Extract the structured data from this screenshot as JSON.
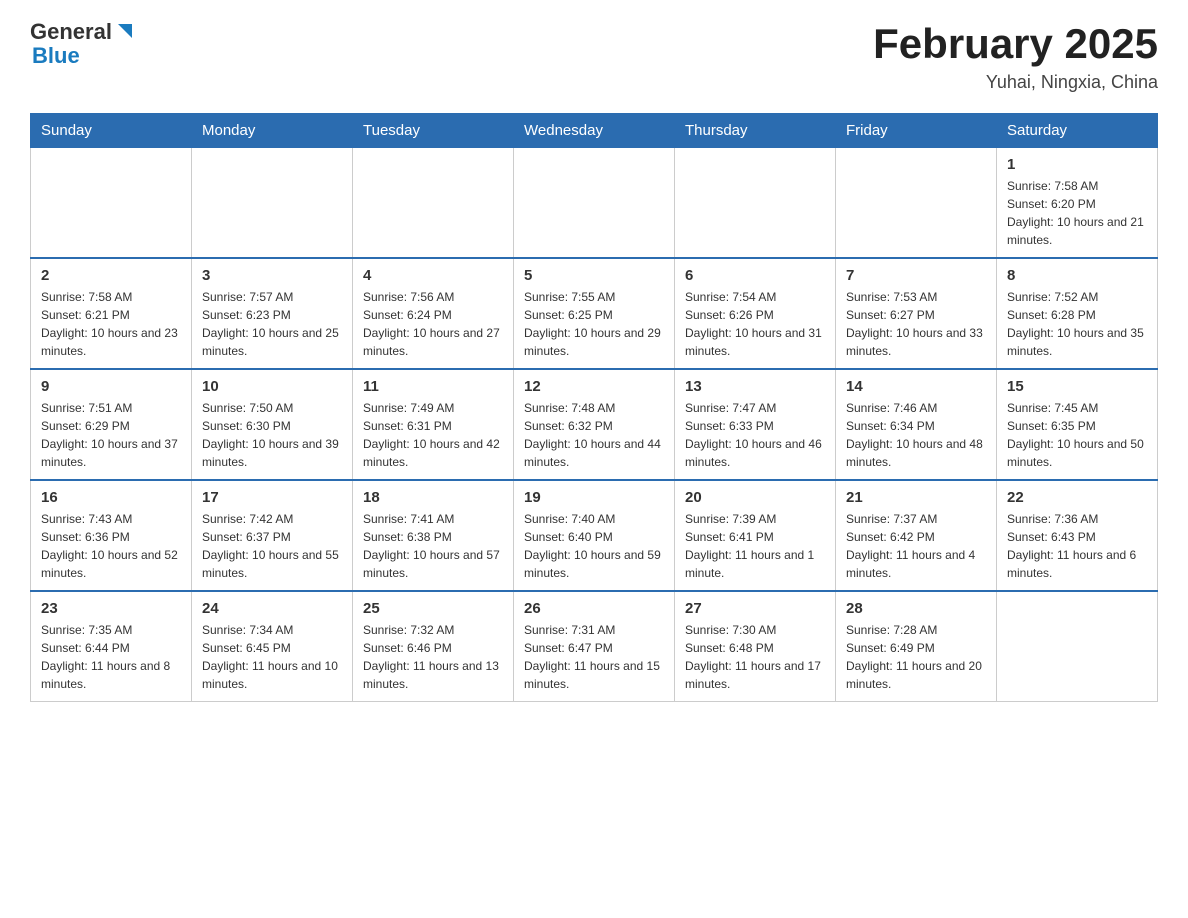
{
  "header": {
    "logo": {
      "general": "General",
      "blue": "Blue"
    },
    "title": "February 2025",
    "subtitle": "Yuhai, Ningxia, China"
  },
  "days_of_week": [
    "Sunday",
    "Monday",
    "Tuesday",
    "Wednesday",
    "Thursday",
    "Friday",
    "Saturday"
  ],
  "weeks": [
    [
      {
        "day": "",
        "info": ""
      },
      {
        "day": "",
        "info": ""
      },
      {
        "day": "",
        "info": ""
      },
      {
        "day": "",
        "info": ""
      },
      {
        "day": "",
        "info": ""
      },
      {
        "day": "",
        "info": ""
      },
      {
        "day": "1",
        "info": "Sunrise: 7:58 AM\nSunset: 6:20 PM\nDaylight: 10 hours and 21 minutes."
      }
    ],
    [
      {
        "day": "2",
        "info": "Sunrise: 7:58 AM\nSunset: 6:21 PM\nDaylight: 10 hours and 23 minutes."
      },
      {
        "day": "3",
        "info": "Sunrise: 7:57 AM\nSunset: 6:23 PM\nDaylight: 10 hours and 25 minutes."
      },
      {
        "day": "4",
        "info": "Sunrise: 7:56 AM\nSunset: 6:24 PM\nDaylight: 10 hours and 27 minutes."
      },
      {
        "day": "5",
        "info": "Sunrise: 7:55 AM\nSunset: 6:25 PM\nDaylight: 10 hours and 29 minutes."
      },
      {
        "day": "6",
        "info": "Sunrise: 7:54 AM\nSunset: 6:26 PM\nDaylight: 10 hours and 31 minutes."
      },
      {
        "day": "7",
        "info": "Sunrise: 7:53 AM\nSunset: 6:27 PM\nDaylight: 10 hours and 33 minutes."
      },
      {
        "day": "8",
        "info": "Sunrise: 7:52 AM\nSunset: 6:28 PM\nDaylight: 10 hours and 35 minutes."
      }
    ],
    [
      {
        "day": "9",
        "info": "Sunrise: 7:51 AM\nSunset: 6:29 PM\nDaylight: 10 hours and 37 minutes."
      },
      {
        "day": "10",
        "info": "Sunrise: 7:50 AM\nSunset: 6:30 PM\nDaylight: 10 hours and 39 minutes."
      },
      {
        "day": "11",
        "info": "Sunrise: 7:49 AM\nSunset: 6:31 PM\nDaylight: 10 hours and 42 minutes."
      },
      {
        "day": "12",
        "info": "Sunrise: 7:48 AM\nSunset: 6:32 PM\nDaylight: 10 hours and 44 minutes."
      },
      {
        "day": "13",
        "info": "Sunrise: 7:47 AM\nSunset: 6:33 PM\nDaylight: 10 hours and 46 minutes."
      },
      {
        "day": "14",
        "info": "Sunrise: 7:46 AM\nSunset: 6:34 PM\nDaylight: 10 hours and 48 minutes."
      },
      {
        "day": "15",
        "info": "Sunrise: 7:45 AM\nSunset: 6:35 PM\nDaylight: 10 hours and 50 minutes."
      }
    ],
    [
      {
        "day": "16",
        "info": "Sunrise: 7:43 AM\nSunset: 6:36 PM\nDaylight: 10 hours and 52 minutes."
      },
      {
        "day": "17",
        "info": "Sunrise: 7:42 AM\nSunset: 6:37 PM\nDaylight: 10 hours and 55 minutes."
      },
      {
        "day": "18",
        "info": "Sunrise: 7:41 AM\nSunset: 6:38 PM\nDaylight: 10 hours and 57 minutes."
      },
      {
        "day": "19",
        "info": "Sunrise: 7:40 AM\nSunset: 6:40 PM\nDaylight: 10 hours and 59 minutes."
      },
      {
        "day": "20",
        "info": "Sunrise: 7:39 AM\nSunset: 6:41 PM\nDaylight: 11 hours and 1 minute."
      },
      {
        "day": "21",
        "info": "Sunrise: 7:37 AM\nSunset: 6:42 PM\nDaylight: 11 hours and 4 minutes."
      },
      {
        "day": "22",
        "info": "Sunrise: 7:36 AM\nSunset: 6:43 PM\nDaylight: 11 hours and 6 minutes."
      }
    ],
    [
      {
        "day": "23",
        "info": "Sunrise: 7:35 AM\nSunset: 6:44 PM\nDaylight: 11 hours and 8 minutes."
      },
      {
        "day": "24",
        "info": "Sunrise: 7:34 AM\nSunset: 6:45 PM\nDaylight: 11 hours and 10 minutes."
      },
      {
        "day": "25",
        "info": "Sunrise: 7:32 AM\nSunset: 6:46 PM\nDaylight: 11 hours and 13 minutes."
      },
      {
        "day": "26",
        "info": "Sunrise: 7:31 AM\nSunset: 6:47 PM\nDaylight: 11 hours and 15 minutes."
      },
      {
        "day": "27",
        "info": "Sunrise: 7:30 AM\nSunset: 6:48 PM\nDaylight: 11 hours and 17 minutes."
      },
      {
        "day": "28",
        "info": "Sunrise: 7:28 AM\nSunset: 6:49 PM\nDaylight: 11 hours and 20 minutes."
      },
      {
        "day": "",
        "info": ""
      }
    ]
  ]
}
